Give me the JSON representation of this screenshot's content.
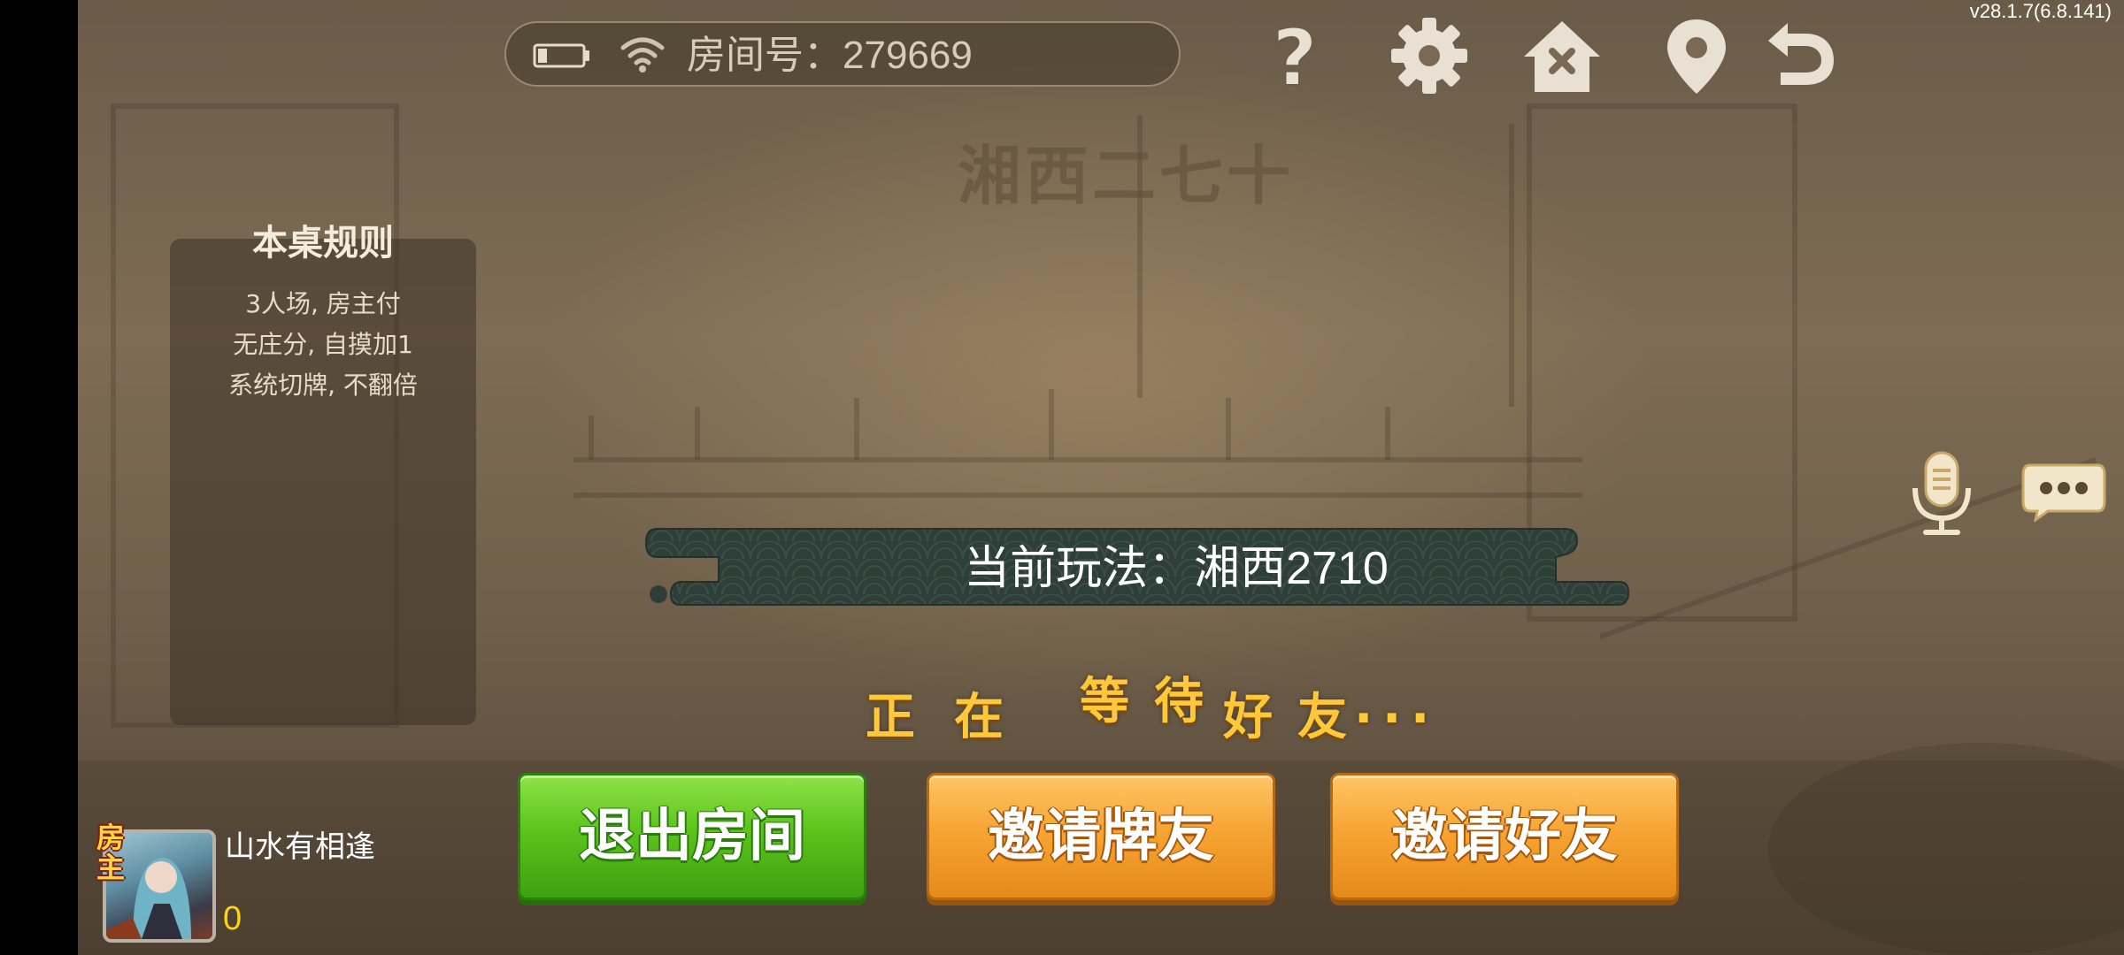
{
  "app": {
    "version": "v28.1.7(6.8.141)"
  },
  "status_bar": {
    "room_label": "房间号：279669",
    "battery_icon": "battery-icon",
    "wifi_icon": "wifi-icon"
  },
  "toolbar": {
    "icons": [
      "help-icon",
      "settings-gear-icon",
      "home-icon",
      "location-pin-icon",
      "back-arrow-icon"
    ]
  },
  "game_title": "湘西二七十",
  "rules": {
    "title": "本桌规则",
    "lines": [
      "3人场, 房主付",
      "无庄分, 自摸加1",
      "系统切牌, 不翻倍"
    ]
  },
  "mode_banner": {
    "text": "当前玩法：湘西2710"
  },
  "waiting": {
    "chars": [
      "正",
      "在",
      "等",
      "待",
      "好",
      "友",
      ".",
      ".",
      "."
    ]
  },
  "buttons": {
    "exit": "退出房间",
    "invite_card_friend": "邀请牌友",
    "invite_friend": "邀请好友"
  },
  "player": {
    "badge": "房主",
    "name": "山水有相逢",
    "score": "0"
  },
  "side_icons": [
    "microphone-icon",
    "chat-bubble-icon"
  ],
  "colors": {
    "button_green": "#5cc41c",
    "button_orange": "#f6a534",
    "waiting_text": "#ffc83a",
    "score": "#ffd21a"
  }
}
